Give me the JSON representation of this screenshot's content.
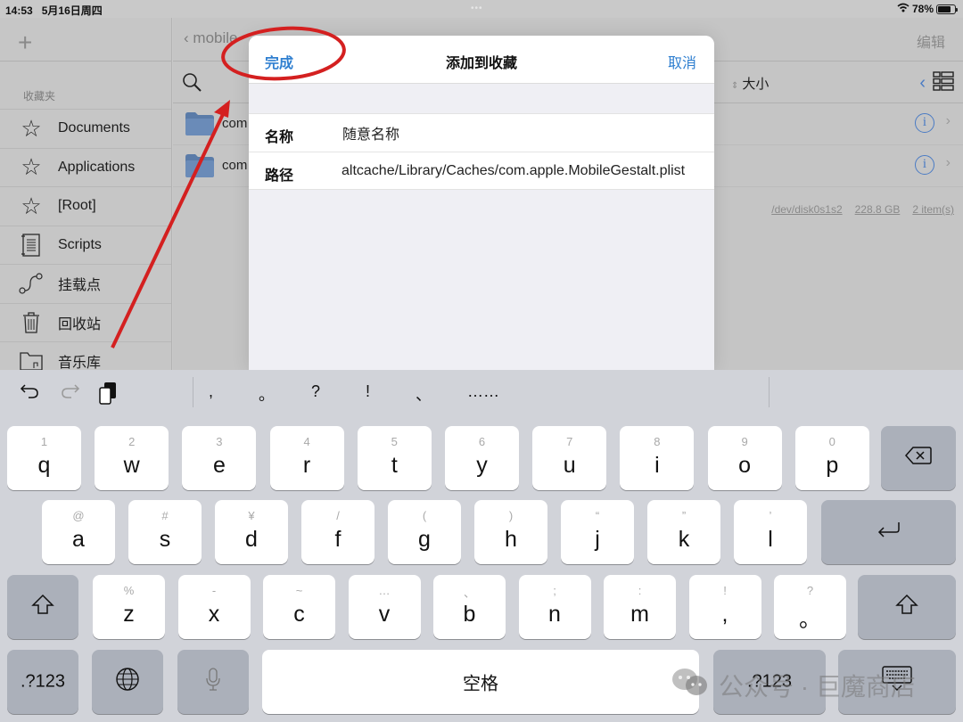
{
  "status_bar": {
    "time": "14:53",
    "date": "5月16日周四",
    "multitask_dots": "•••",
    "battery_percent": "78%",
    "battery_level": 0.78
  },
  "sidebar": {
    "add_icon": "plus-icon",
    "section_label": "收藏夹",
    "items": [
      {
        "label": "Documents",
        "icon": "star-icon"
      },
      {
        "label": "Applications",
        "icon": "star-icon"
      },
      {
        "label": "[Root]",
        "icon": "star-icon"
      },
      {
        "label": "Scripts",
        "icon": "script-icon"
      },
      {
        "label": "挂载点",
        "icon": "mount-point-icon"
      },
      {
        "label": "回收站",
        "icon": "trash-icon"
      },
      {
        "label": "音乐库",
        "icon": "music-folder-icon"
      }
    ]
  },
  "main": {
    "back_label": "mobile",
    "edit_label": "编辑",
    "sort_label": "大小",
    "files": [
      {
        "name": "com"
      },
      {
        "name": "com"
      }
    ],
    "footer": {
      "device": "/dev/disk0s1s2",
      "capacity": "228.8 GB",
      "items": "2 item(s)"
    }
  },
  "modal": {
    "done_label": "完成",
    "title": "添加到收藏",
    "cancel_label": "取消",
    "fields": [
      {
        "label": "名称",
        "value": "随意名称"
      },
      {
        "label": "路径",
        "value": "altcache/Library/Caches/com.apple.MobileGestalt.plist"
      }
    ]
  },
  "annotation": {
    "color": "#d42020"
  },
  "keyboard": {
    "punctuation": [
      ",",
      "。",
      "?",
      "!",
      "、",
      "……"
    ],
    "row1": [
      {
        "alt": "1",
        "key": "q"
      },
      {
        "alt": "2",
        "key": "w"
      },
      {
        "alt": "3",
        "key": "e"
      },
      {
        "alt": "4",
        "key": "r"
      },
      {
        "alt": "5",
        "key": "t"
      },
      {
        "alt": "6",
        "key": "y"
      },
      {
        "alt": "7",
        "key": "u"
      },
      {
        "alt": "8",
        "key": "i"
      },
      {
        "alt": "9",
        "key": "o"
      },
      {
        "alt": "0",
        "key": "p"
      }
    ],
    "row2": [
      {
        "alt": "@",
        "key": "a"
      },
      {
        "alt": "#",
        "key": "s"
      },
      {
        "alt": "¥",
        "key": "d"
      },
      {
        "alt": "/",
        "key": "f"
      },
      {
        "alt": "(",
        "key": "g"
      },
      {
        "alt": ")",
        "key": "h"
      },
      {
        "alt": "“",
        "key": "j"
      },
      {
        "alt": "”",
        "key": "k"
      },
      {
        "alt": "’",
        "key": "l"
      }
    ],
    "row3": [
      {
        "alt": "%",
        "key": "z"
      },
      {
        "alt": "-",
        "key": "x"
      },
      {
        "alt": "~",
        "key": "c"
      },
      {
        "alt": "…",
        "key": "v"
      },
      {
        "alt": "、",
        "key": "b"
      },
      {
        "alt": ";",
        "key": "n"
      },
      {
        "alt": ":",
        "key": "m"
      },
      {
        "alt": "!",
        "key": ","
      },
      {
        "alt": "?",
        "key": "。"
      }
    ],
    "numbers_label": ".?123",
    "space_label": "空格"
  },
  "watermark": {
    "text": "公众号 · 巨魔商店"
  }
}
